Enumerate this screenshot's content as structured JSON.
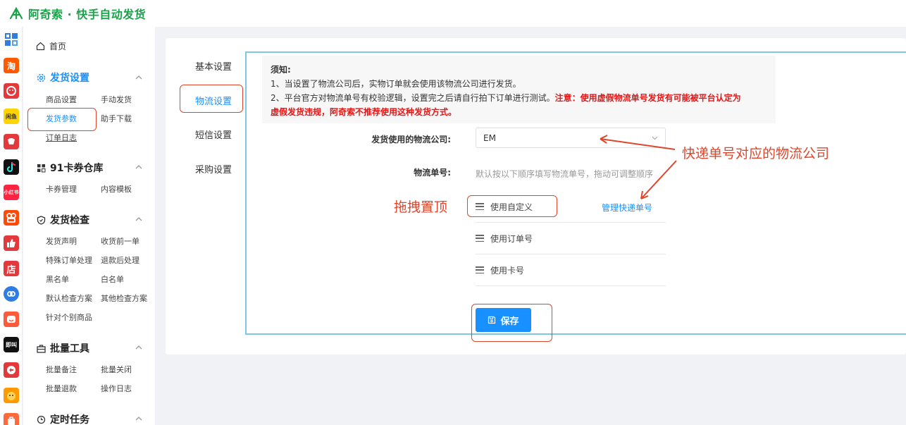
{
  "app": {
    "title": "阿奇索 · 快手自动发货"
  },
  "apps": [
    {
      "name": "grid-app-icon",
      "color": "#2f7de1"
    },
    {
      "name": "taobao-app-icon",
      "label": "淘",
      "color": "#ff5a00"
    },
    {
      "name": "tmall-app-icon",
      "color": "#e4393c"
    },
    {
      "name": "xianyu-app-icon",
      "label": "闲鱼",
      "color": "#ffd400"
    },
    {
      "name": "jd-app-icon",
      "color": "#e4393c"
    },
    {
      "name": "douyin-app-icon",
      "color": "#111111"
    },
    {
      "name": "xiaohongshu-app-icon",
      "label": "小红书",
      "color": "#ff2442"
    },
    {
      "name": "kuaishou-app-icon",
      "color": "#ff4906"
    },
    {
      "name": "thumb-app-icon",
      "color": "#e4393c"
    },
    {
      "name": "shop-app-icon",
      "label": "店",
      "color": "#e4393c"
    },
    {
      "name": "link-app-icon",
      "color": "#2f7de1"
    },
    {
      "name": "face-app-icon",
      "color": "#ff5a3c"
    },
    {
      "name": "media-app-icon",
      "label": "即叫",
      "color": "#111111"
    },
    {
      "name": "arrow-app-icon",
      "color": "#e4393c"
    },
    {
      "name": "tiger-app-icon",
      "color": "#ff9a00"
    },
    {
      "name": "bag-app-icon",
      "color": "#ff6a3c"
    }
  ],
  "menu": {
    "home": "首页",
    "groups": [
      {
        "title": "发货设置",
        "items": [
          "商品设置",
          "手动发货",
          "发货参数",
          "助手下载",
          "订单日志"
        ]
      },
      {
        "title": "91卡券仓库",
        "items": [
          "卡券管理",
          "内容模板"
        ]
      },
      {
        "title": "发货检查",
        "items": [
          "发货声明",
          "收货前一单",
          "特殊订单处理",
          "退款后处理",
          "黑名单",
          "白名单",
          "默认检查方案",
          "其他检查方案",
          "针对个别商品"
        ]
      },
      {
        "title": "批量工具",
        "items": [
          "批量备注",
          "批量关闭",
          "批量退款",
          "操作日志"
        ]
      },
      {
        "title": "定时任务"
      }
    ]
  },
  "tabs": [
    "基本设置",
    "物流设置",
    "短信设置",
    "采购设置"
  ],
  "notice": {
    "title": "须知:",
    "line1": "1、当设置了物流公司后，实物订单就会使用该物流公司进行发货。",
    "line2a": "2、平台官方对物流单号有校验逻辑，设置完之后请自行拍下订单进行测试。",
    "line2b": "注意：使用虚假物流单号发货有可能被平台认定为",
    "line3": "虚假发货违规，阿奇索不推荐使用这种发货方式。"
  },
  "form": {
    "company_label": "发货使用的物流公司:",
    "company_value": "EM",
    "tracking_label": "物流单号:",
    "tracking_hint": "默认按以下顺序填写物流单号，拖动可调整顺序",
    "order": [
      "使用自定义",
      "使用订单号",
      "使用卡号"
    ],
    "manage_link": "管理快递单号",
    "save": "保存"
  },
  "annotations": {
    "company": "快递单号对应的物流公司",
    "drag": "拖拽置顶"
  },
  "colors": {
    "brand": "#1aa34a",
    "primary": "#1890ff",
    "warn": "#e41717",
    "annotation": "#e0452a"
  }
}
